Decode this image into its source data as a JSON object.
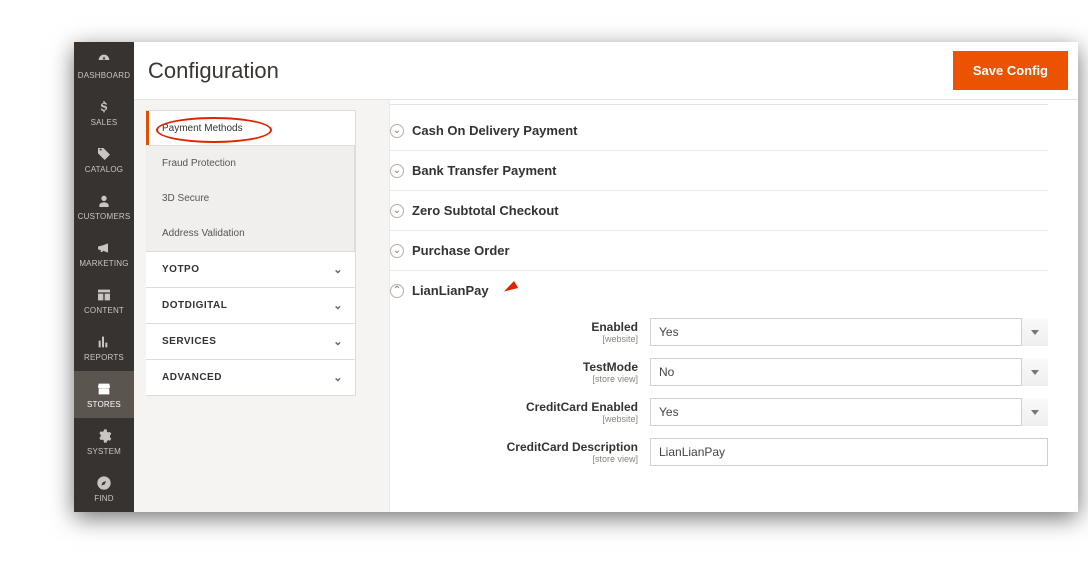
{
  "header": {
    "title": "Configuration",
    "save_label": "Save Config"
  },
  "admin_nav": [
    {
      "id": "dashboard",
      "label": "DASHBOARD"
    },
    {
      "id": "sales",
      "label": "SALES"
    },
    {
      "id": "catalog",
      "label": "CATALOG"
    },
    {
      "id": "customers",
      "label": "CUSTOMERS"
    },
    {
      "id": "marketing",
      "label": "MARKETING"
    },
    {
      "id": "content",
      "label": "CONTENT"
    },
    {
      "id": "reports",
      "label": "REPORTS"
    },
    {
      "id": "stores",
      "label": "STORES",
      "active": true
    },
    {
      "id": "system",
      "label": "SYSTEM"
    },
    {
      "id": "find",
      "label": "FIND"
    }
  ],
  "settings_panel": {
    "active_tab": "Payment Methods",
    "sub_items": [
      "Fraud Protection",
      "3D Secure",
      "Address Validation"
    ],
    "groups": [
      "YOTPO",
      "DOTDIGITAL",
      "SERVICES",
      "ADVANCED"
    ]
  },
  "accordion": [
    {
      "label": "Cash On Delivery Payment",
      "open": false
    },
    {
      "label": "Bank Transfer Payment",
      "open": false
    },
    {
      "label": "Zero Subtotal Checkout",
      "open": false
    },
    {
      "label": "Purchase Order",
      "open": false
    },
    {
      "label": "LianLianPay",
      "open": true,
      "highlight": true
    }
  ],
  "form": {
    "fields": [
      {
        "label": "Enabled",
        "scope": "[website]",
        "type": "select",
        "value": "Yes"
      },
      {
        "label": "TestMode",
        "scope": "[store view]",
        "type": "select",
        "value": "No"
      },
      {
        "label": "CreditCard Enabled",
        "scope": "[website]",
        "type": "select",
        "value": "Yes"
      },
      {
        "label": "CreditCard Description",
        "scope": "[store view]",
        "type": "text",
        "value": "LianLianPay"
      }
    ]
  }
}
